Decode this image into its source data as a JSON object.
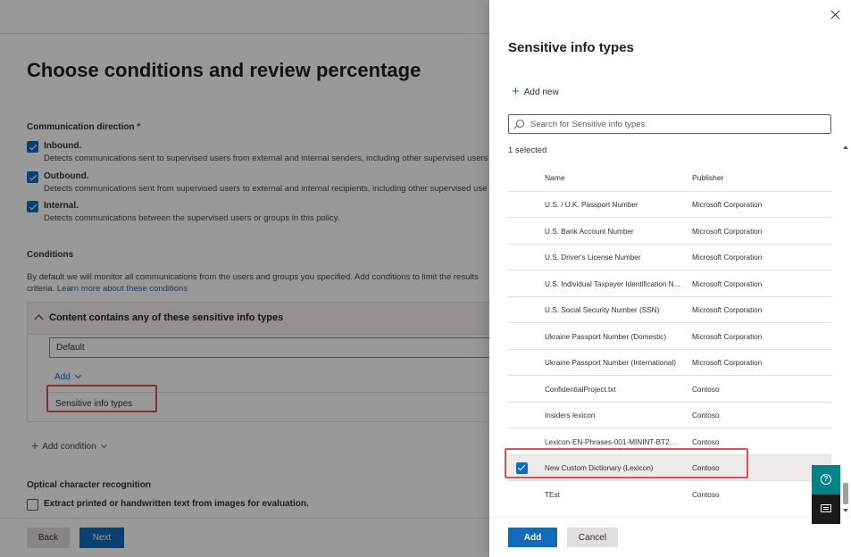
{
  "background": {
    "page_title": "Choose conditions and review percentage",
    "communication_direction": {
      "label": "Communication direction",
      "required_mark": "*",
      "options": [
        {
          "title": "Inbound.",
          "description": "Detects communications sent to supervised users from external and internal senders, including other supervised users",
          "checked": true
        },
        {
          "title": "Outbound.",
          "description": "Detects communications sent from supervised users to external and internal recipients, including other supervised use",
          "checked": true
        },
        {
          "title": "Internal.",
          "description": "Detects communications between the supervised users or groups in this policy.",
          "checked": true
        }
      ]
    },
    "conditions": {
      "label": "Conditions",
      "description_line1": "By default we will monitor all communications from the users and groups you specified. Add conditions to limit the results",
      "description_line2_prefix": "criteria.",
      "learn_more_link": "Learn more about these conditions",
      "box_title": "Content contains any of these sensitive info types",
      "default_value": "Default",
      "add_label": "Add",
      "sensitive_info_types_label": "Sensitive info types",
      "add_condition_label": "Add condition"
    },
    "ocr": {
      "label": "Optical character recognition",
      "checkbox_label": "Extract printed or handwritten text from images for evaluation.",
      "checked": false
    },
    "footer": {
      "back_label": "Back",
      "next_label": "Next"
    }
  },
  "panel": {
    "title": "Sensitive info types",
    "add_new_label": "Add new",
    "search_placeholder": "Search for Sensitive info types",
    "selected_count": "1 selected",
    "columns": {
      "name": "Name",
      "publisher": "Publisher"
    },
    "rows": [
      {
        "name": "U.S. / U.K. Passport Number",
        "publisher": "Microsoft Corporation",
        "selected": false
      },
      {
        "name": "U.S. Bank Account Number",
        "publisher": "Microsoft Corporation",
        "selected": false
      },
      {
        "name": "U.S. Driver's License Number",
        "publisher": "Microsoft Corporation",
        "selected": false
      },
      {
        "name": "U.S. Individual Taxpayer Identification N...",
        "publisher": "Microsoft Corporation",
        "selected": false
      },
      {
        "name": "U.S. Social Security Number (SSN)",
        "publisher": "Microsoft Corporation",
        "selected": false
      },
      {
        "name": "Ukraine Passport Number (Domestic)",
        "publisher": "Microsoft Corporation",
        "selected": false
      },
      {
        "name": "Ukraine Passport Number (International)",
        "publisher": "Microsoft Corporation",
        "selected": false
      },
      {
        "name": "ConfidentialProject.txt",
        "publisher": "Contoso",
        "selected": false
      },
      {
        "name": "Insiders lexicon",
        "publisher": "Contoso",
        "selected": false
      },
      {
        "name": "Lexicon-EN-Phrases-001-MININT-BT2H...",
        "publisher": "Contoso",
        "selected": false
      },
      {
        "name": "New Custom Dictionary (Lexicon)",
        "publisher": "Contoso",
        "selected": true
      },
      {
        "name": "TEst",
        "publisher": "Contoso",
        "selected": false
      }
    ],
    "footer": {
      "add_label": "Add",
      "cancel_label": "Cancel"
    }
  },
  "floating_buttons": {
    "help_icon": "help-icon",
    "feedback_icon": "feedback-icon"
  },
  "colors": {
    "accent": "#0f6cbd",
    "highlight_box": "#d9534f",
    "help_button": "#038387"
  }
}
